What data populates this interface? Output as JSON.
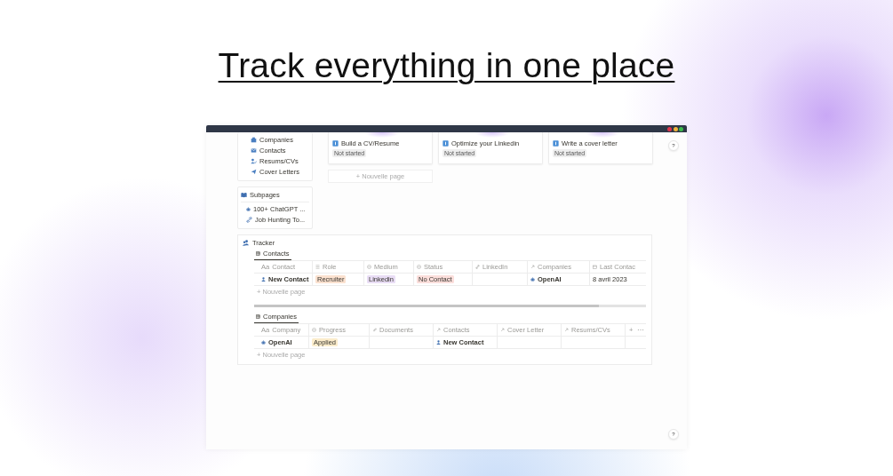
{
  "heading": "Track everything in one place",
  "window": {
    "nav": [
      {
        "label": "Companies"
      },
      {
        "label": "Contacts"
      },
      {
        "label": "Resums/CVs"
      },
      {
        "label": "Cover Letters"
      }
    ],
    "subpages": {
      "title": "Subpages",
      "items": [
        {
          "label": "100+ ChatGPT ..."
        },
        {
          "label": "Job Hunting To..."
        }
      ]
    },
    "tasks": [
      {
        "title": "Build a CV/Resume",
        "status": "Not started"
      },
      {
        "title": "Optimize your Linkedin",
        "status": "Not started"
      },
      {
        "title": "Write a cover letter",
        "status": "Not started"
      }
    ],
    "new_page": "+ Nouvelle page",
    "help": [
      "?",
      "?"
    ],
    "tracker": {
      "title": "Tracker",
      "tables": [
        {
          "tab": {
            "label": "Contacts",
            "selected": true
          },
          "columns": [
            {
              "kind": "title",
              "icon_text": "Aa",
              "label": "Contact"
            },
            {
              "kind": "select",
              "label": "Role"
            },
            {
              "kind": "status",
              "label": "Medium"
            },
            {
              "kind": "status",
              "label": "Status"
            },
            {
              "kind": "url",
              "label": "LinkedIn"
            },
            {
              "kind": "relation",
              "label": "Companies"
            },
            {
              "kind": "date",
              "label": "Last Contac"
            }
          ],
          "rows": [
            {
              "cells": [
                {
                  "kind": "person",
                  "text": "New Contact"
                },
                {
                  "kind": "tag",
                  "text": "Recruiter",
                  "color": "#fbe1cf"
                },
                {
                  "kind": "tag",
                  "text": "Linkedin",
                  "color": "#e9ddf5"
                },
                {
                  "kind": "tag",
                  "text": "No Contact",
                  "color": "#fbdedb"
                },
                {
                  "kind": "empty"
                },
                {
                  "kind": "company",
                  "text": "OpenAI"
                },
                {
                  "kind": "text",
                  "text": "8 avril 2023"
                }
              ]
            }
          ],
          "new_row": "+ Nouvelle page"
        },
        {
          "tab": {
            "label": "Companies",
            "selected": true
          },
          "columns": [
            {
              "kind": "title",
              "icon_text": "Aa",
              "label": "Company"
            },
            {
              "kind": "status",
              "label": "Progress"
            },
            {
              "kind": "files",
              "label": "Documents"
            },
            {
              "kind": "relation",
              "label": "Contacts"
            },
            {
              "kind": "relation",
              "label": "Cover Letter"
            },
            {
              "kind": "relation",
              "label": "Resums/CVs"
            }
          ],
          "actions": [
            "+",
            "⋯"
          ],
          "rows": [
            {
              "cells": [
                {
                  "kind": "company",
                  "text": "OpenAI"
                },
                {
                  "kind": "tag",
                  "text": "Applied",
                  "color": "#fbeccb"
                },
                {
                  "kind": "empty"
                },
                {
                  "kind": "person",
                  "text": "New Contact"
                },
                {
                  "kind": "empty"
                },
                {
                  "kind": "empty"
                }
              ]
            }
          ],
          "new_row": "+ Nouvelle page"
        }
      ]
    }
  }
}
